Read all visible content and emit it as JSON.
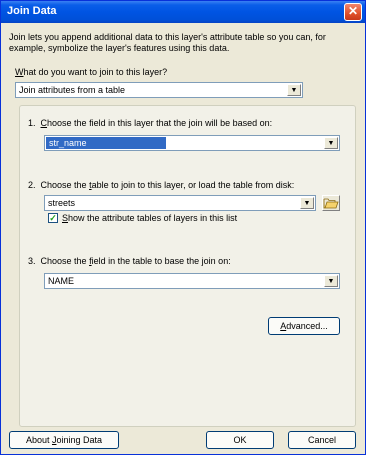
{
  "window": {
    "title": "Join Data",
    "close_symbol": "✕"
  },
  "description": "Join lets you append additional data to this layer's attribute table so you can, for example, symbolize the layer's features using this data.",
  "question": {
    "prefix": "",
    "underline": "W",
    "rest": "hat do you want to join to this layer?"
  },
  "join_type": {
    "selected": "Join attributes from a table"
  },
  "step1": {
    "number": "1.",
    "prefix": "",
    "underline": "C",
    "rest": "hoose the field in this layer that the join will be based on:",
    "selected": "str_name"
  },
  "step2": {
    "number": "2.",
    "pre": "Choose the ",
    "underline": "t",
    "rest": "able to join to this layer, or load the table from disk:",
    "selected": "streets"
  },
  "show_attr": {
    "checked": "✓",
    "underline": "S",
    "rest": "how the attribute tables of layers in this list"
  },
  "step3": {
    "number": "3.",
    "pre": "Choose the ",
    "underline": "f",
    "rest": "ield in the table to base the join on:",
    "selected": "NAME"
  },
  "buttons": {
    "advanced": {
      "underline": "A",
      "rest": "dvanced..."
    },
    "about": {
      "pre": "About ",
      "underline": "J",
      "rest": "oining Data"
    },
    "ok": "OK",
    "cancel": "Cancel"
  },
  "icons": {
    "dropdown": "▼",
    "folder": "folder-open-icon"
  }
}
